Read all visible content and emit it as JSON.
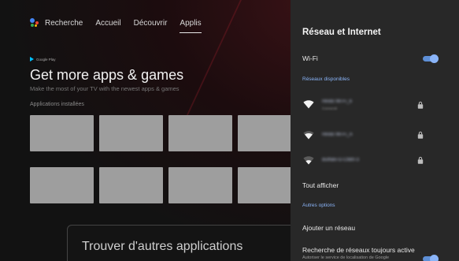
{
  "top_nav": {
    "items": [
      "Recherche",
      "Accueil",
      "Découvrir",
      "Applis"
    ],
    "active": "Applis"
  },
  "banner": {
    "brand": "Google Play",
    "headline": "Get more apps & games",
    "subline": "Make the most of your TV with the newest apps & games"
  },
  "installed_label": "Applications installées",
  "find_card": "Trouver d'autres applications",
  "panel": {
    "title": "Réseau et Internet",
    "wifi_label": "Wi-Fi",
    "wifi_on": true,
    "available_header": "Réseaux disponibles",
    "networks": [
      {
        "name": "Hindo Wi-Fi_6",
        "status": "Connecté",
        "icon": "wifi-full-icon",
        "locked": true
      },
      {
        "name": "Hindo Wi-Fi_A",
        "status": "",
        "icon": "wifi-medium-icon",
        "locked": true
      },
      {
        "name": "Buffalo-G-C680-3",
        "status": "",
        "icon": "wifi-low-icon",
        "locked": true
      }
    ],
    "see_all": "Tout afficher",
    "other_header": "Autres options",
    "add_network": "Ajouter un réseau",
    "always_scan": "Recherche de réseaux toujours active",
    "always_scan_sub": "Autoriser le service de localisation de Google",
    "always_scan_on": true
  },
  "colors": {
    "accent_blue": "#8ab4f8",
    "panel_bg": "#282828",
    "tile_grey": "#9e9e9e"
  }
}
